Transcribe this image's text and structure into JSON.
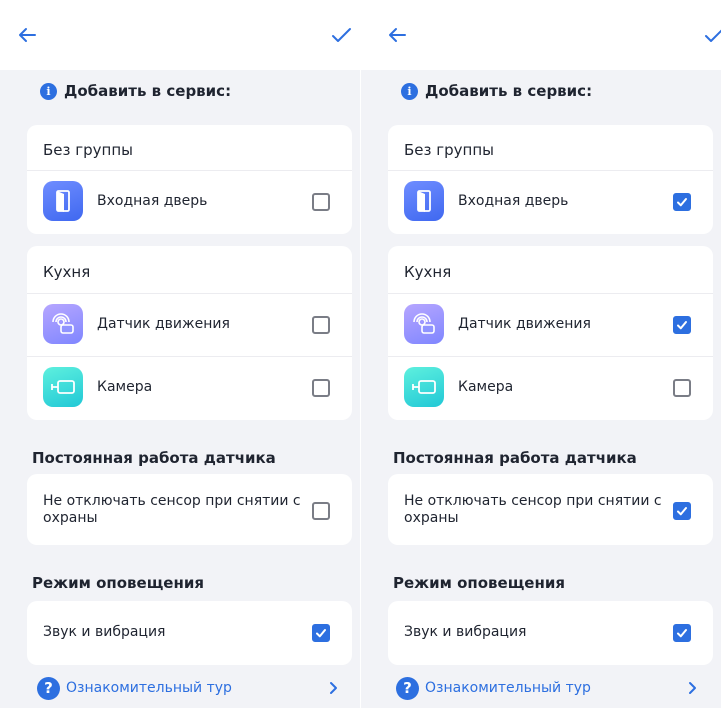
{
  "screens": [
    {
      "info_title": "Добавить в сервис:",
      "groups": [
        {
          "title": "Без группы",
          "items": [
            {
              "label": "Входная дверь",
              "icon": "door-icon",
              "checked": false
            }
          ]
        },
        {
          "title": "Кухня",
          "items": [
            {
              "label": "Датчик движения",
              "icon": "motion-sensor-icon",
              "checked": false
            },
            {
              "label": "Камера",
              "icon": "camera-icon",
              "checked": false
            }
          ]
        }
      ],
      "sensor_section": {
        "title": "Постоянная работа датчика",
        "label": "Не отключать сенсор при снятии с охраны",
        "checked": false
      },
      "notify_section": {
        "title": "Режим оповещения",
        "label": "Звук и вибрация",
        "checked": true
      },
      "tour_label": "Ознакомительный тур"
    },
    {
      "info_title": "Добавить в сервис:",
      "groups": [
        {
          "title": "Без группы",
          "items": [
            {
              "label": "Входная дверь",
              "icon": "door-icon",
              "checked": true
            }
          ]
        },
        {
          "title": "Кухня",
          "items": [
            {
              "label": "Датчик движения",
              "icon": "motion-sensor-icon",
              "checked": true
            },
            {
              "label": "Камера",
              "icon": "camera-icon",
              "checked": false
            }
          ]
        }
      ],
      "sensor_section": {
        "title": "Постоянная работа датчика",
        "label": "Не отключать сенсор при снятии с охраны",
        "checked": true
      },
      "notify_section": {
        "title": "Режим оповещения",
        "label": "Звук и вибрация",
        "checked": true
      },
      "tour_label": "Ознакомительный тур"
    }
  ],
  "colors": {
    "accent": "#2d6fe0",
    "background": "#f2f3f7",
    "card": "#ffffff",
    "text": "#1f2430"
  }
}
